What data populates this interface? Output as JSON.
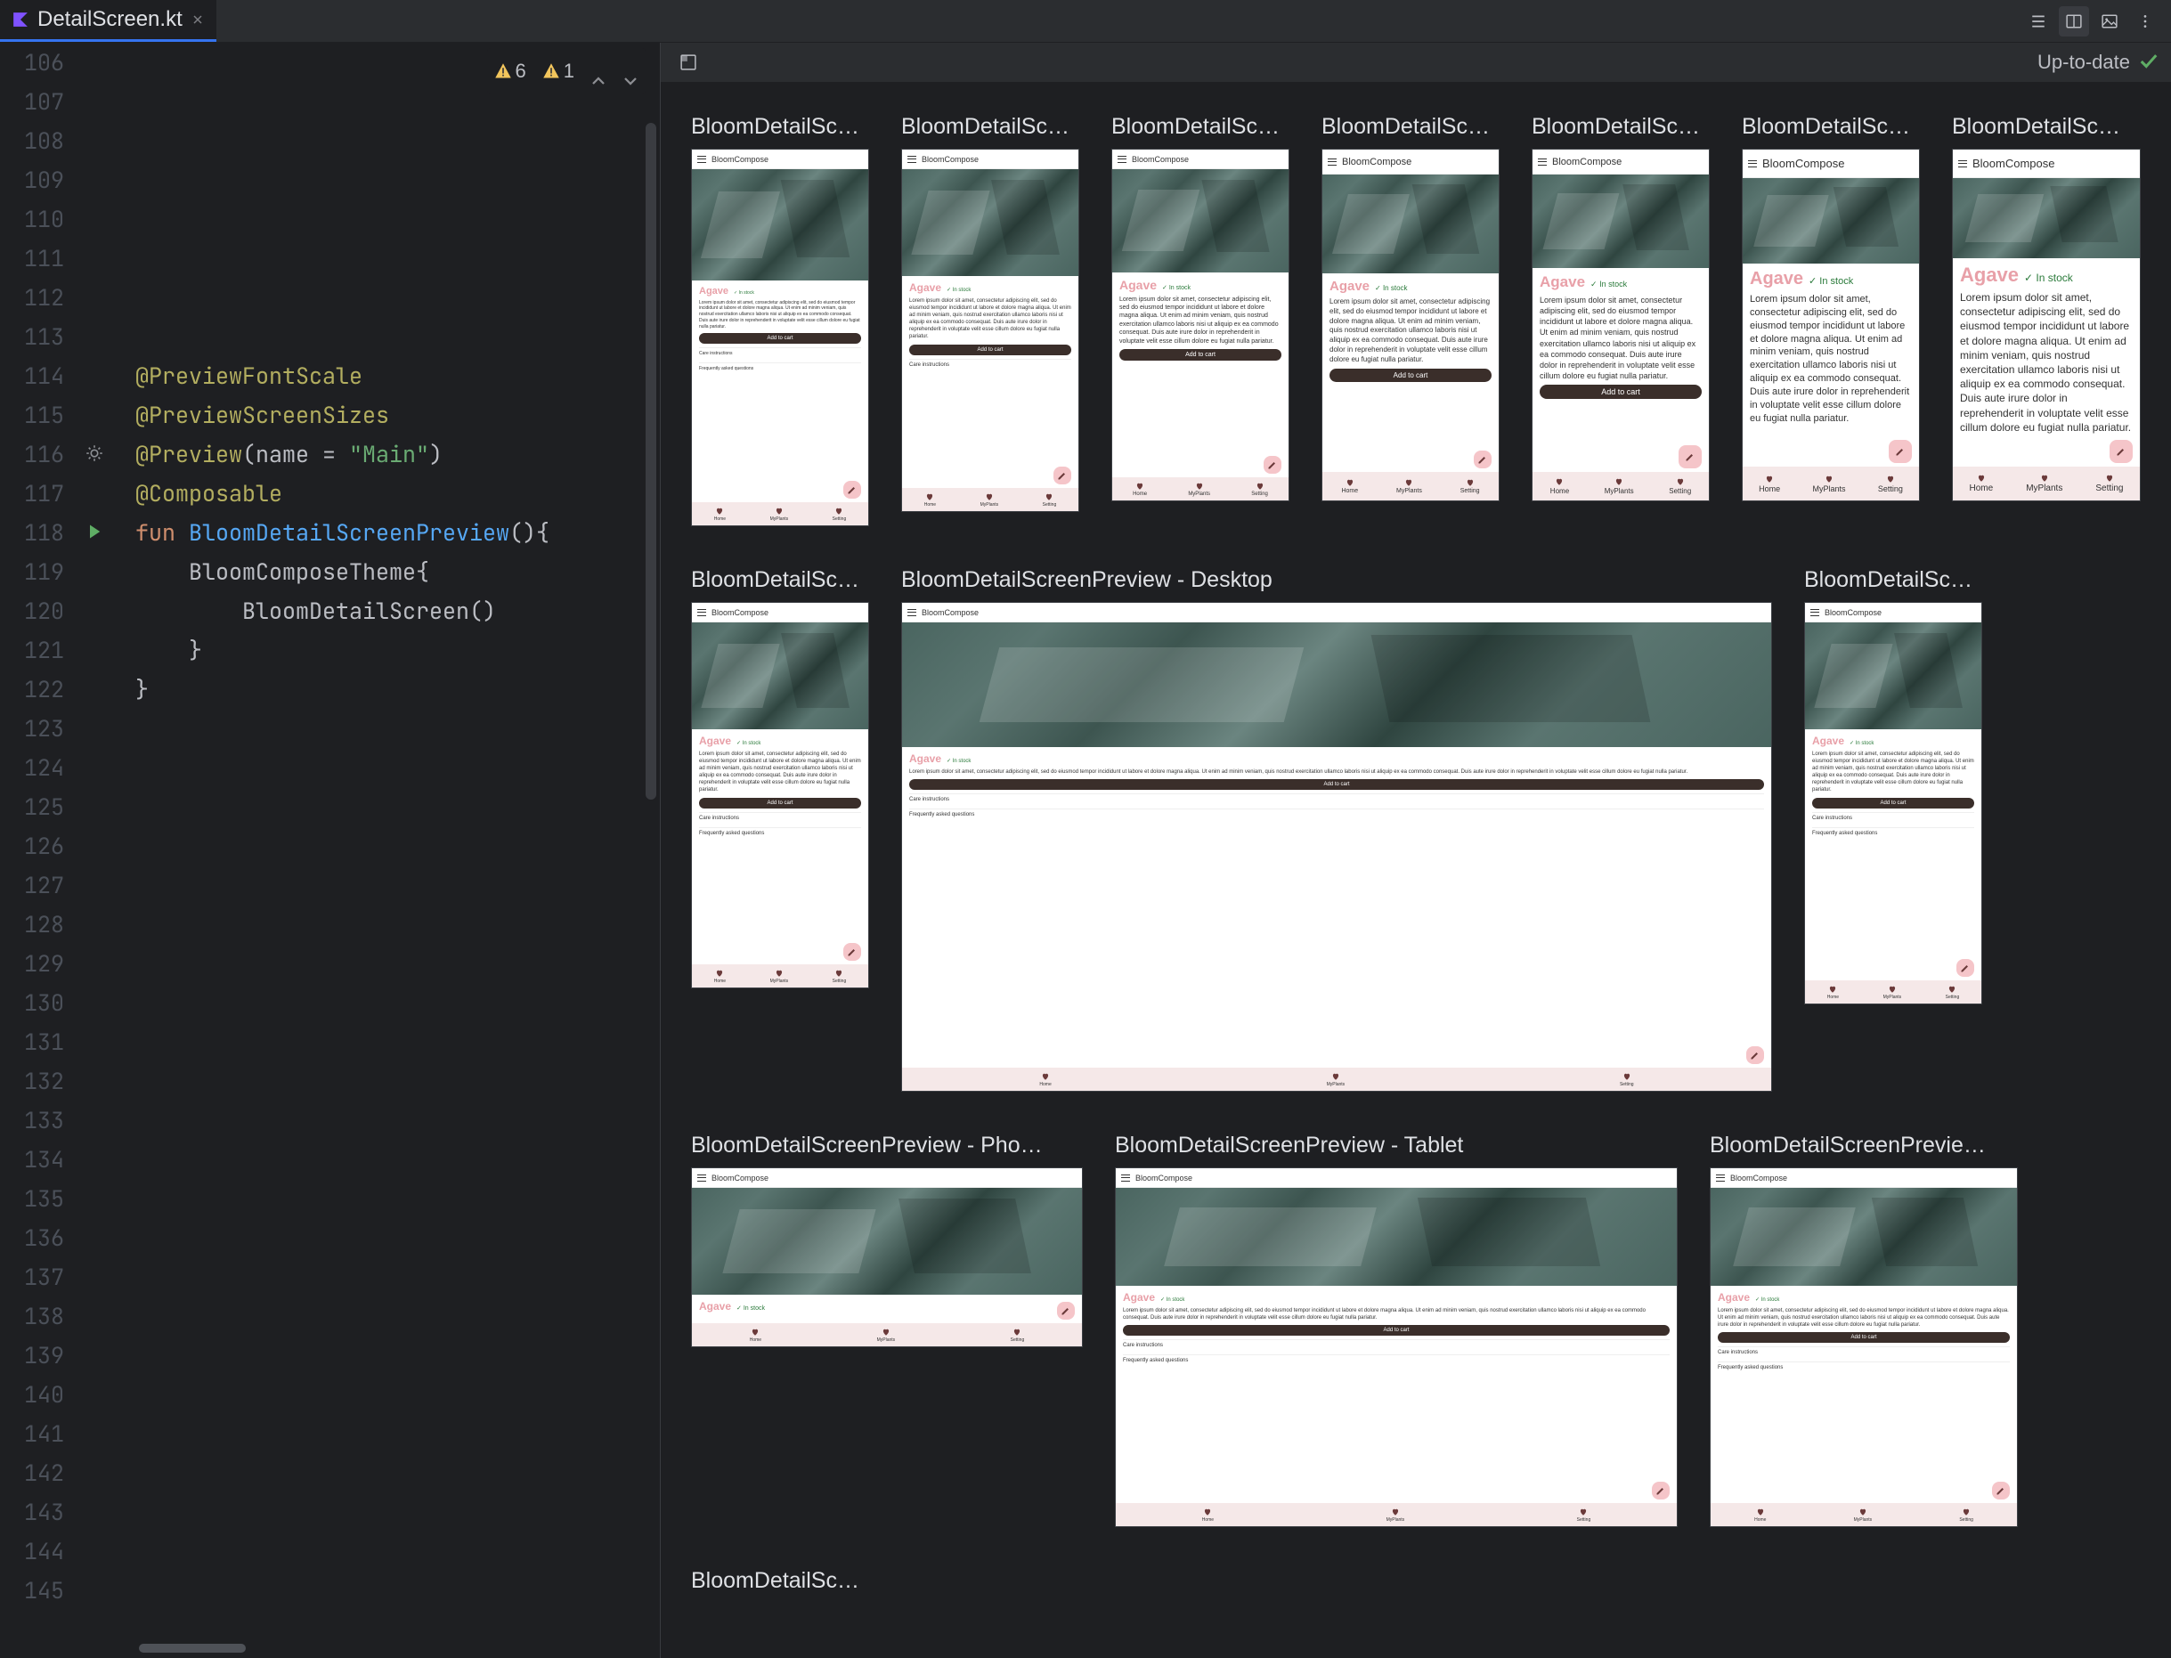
{
  "tab": {
    "filename": "DetailScreen.kt"
  },
  "toolbar": {
    "warnings1_count": "6",
    "warnings2_count": "1"
  },
  "preview_status": "Up-to-date",
  "gutter_start": 106,
  "gutter_end": 145,
  "highlighted_line": 116,
  "run_line": 118,
  "code_lines": {
    "114": {
      "ann": "@PreviewFontScale"
    },
    "115": {
      "ann": "@PreviewScreenSizes"
    },
    "116": {
      "prefix": "@Preview",
      "rest1": "(name = ",
      "str": "\"Main\"",
      "rest2": ")"
    },
    "117": {
      "ann": "@Composable"
    },
    "118": {
      "kw": "fun",
      "fn": " BloomDetailScreenPreview",
      "rest": "(){"
    },
    "119": {
      "indent": "    ",
      "call": "BloomComposeTheme",
      "rest": "{"
    },
    "120": {
      "indent": "        ",
      "call": "BloomDetailScreen",
      "rest": "()"
    },
    "121": {
      "indent": "    ",
      "rest": "}"
    },
    "122": {
      "rest": "}"
    }
  },
  "app": {
    "title": "BloomCompose",
    "plant": "Agave",
    "stock": "In stock",
    "stock_short": "In stock",
    "lorem": "Lorem ipsum dolor sit amet, consectetur adipiscing elit, sed do eiusmod tempor incididunt ut labore et dolore magna aliqua. Ut enim ad minim veniam, quis nostrud exercitation ullamco laboris nisi ut aliquip ex ea commodo consequat. Duis aute irure dolor in reprehenderit in voluptate velit esse cillum dolore eu fugiat nulla pariatur.",
    "add_to_cart": "Add to cart",
    "care": "Care instructions",
    "faq": "Frequently asked questions",
    "nav": {
      "home": "Home",
      "myplants": "MyPlants",
      "setting": "Setting"
    }
  },
  "previews": {
    "row1": [
      {
        "label": "BloomDetailSc…",
        "size": "d-phone-85",
        "scale": 0.85
      },
      {
        "label": "BloomDetailSc…",
        "size": "d-phone-100",
        "scale": 1.0
      },
      {
        "label": "BloomDetailSc…",
        "size": "d-phone-115",
        "scale": 1.15
      },
      {
        "label": "BloomDetailSc…",
        "size": "d-phone-130",
        "scale": 1.3
      },
      {
        "label": "BloomDetailSc…",
        "size": "d-phone-150",
        "scale": 1.5
      },
      {
        "label": "BloomDetailSc…",
        "size": "d-phone-180",
        "scale": 1.8
      },
      {
        "label": "BloomDetailSc…",
        "size": "d-phone-200",
        "scale": 2.0
      }
    ],
    "row2": [
      {
        "label": "BloomDetailSc…",
        "size": "d-foldable"
      },
      {
        "label": "BloomDetailScreenPreview - Desktop",
        "size": "d-desktop"
      },
      {
        "label": "BloomDetailSc…",
        "size": "d-medium"
      }
    ],
    "row3": [
      {
        "label": "BloomDetailScreenPreview - Pho…",
        "size": "d-landscape"
      },
      {
        "label": "BloomDetailScreenPreview - Tablet",
        "size": "d-tablet"
      },
      {
        "label": "BloomDetailScreenPrevie…",
        "size": "d-unfolded"
      }
    ],
    "row4": [
      {
        "label": "BloomDetailSc…"
      }
    ]
  }
}
